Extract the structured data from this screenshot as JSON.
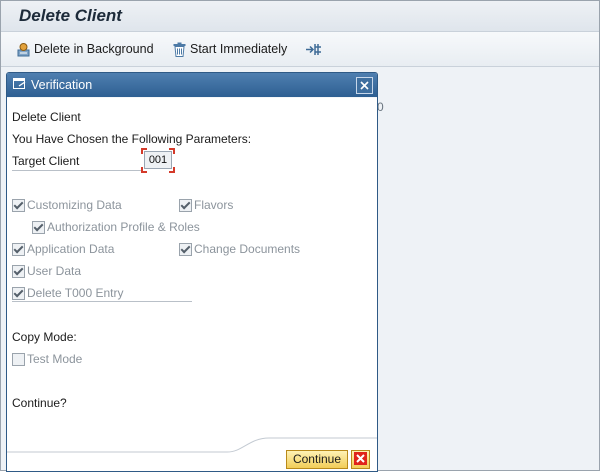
{
  "header": {
    "title": "Delete Client"
  },
  "toolbar": {
    "delete_background": "Delete in Background",
    "start_immediately": "Start Immediately"
  },
  "background_text": "0",
  "dialog": {
    "title": "Verification",
    "heading": "Delete Client",
    "subheading": "You Have Chosen the Following Parameters:",
    "target_client_label": "Target Client",
    "target_client_value": "001",
    "options": {
      "customizing_data": {
        "label": "Customizing Data",
        "checked": true
      },
      "flavors": {
        "label": "Flavors",
        "checked": true
      },
      "authorization_profile_roles": {
        "label": "Authorization Profile & Roles",
        "checked": true
      },
      "application_data": {
        "label": "Application Data",
        "checked": true
      },
      "change_documents": {
        "label": "Change Documents",
        "checked": true
      },
      "user_data": {
        "label": "User Data",
        "checked": true
      },
      "delete_t000_entry": {
        "label": "Delete T000 Entry",
        "checked": true
      }
    },
    "copy_mode_label": "Copy Mode:",
    "test_mode": {
      "label": "Test Mode",
      "checked": false
    },
    "continue_question": "Continue?",
    "continue_button": "Continue"
  },
  "colors": {
    "dialog_header": "#2e5f92",
    "button_yellow": "#f2cd58",
    "cancel_red": "#e0241b"
  }
}
